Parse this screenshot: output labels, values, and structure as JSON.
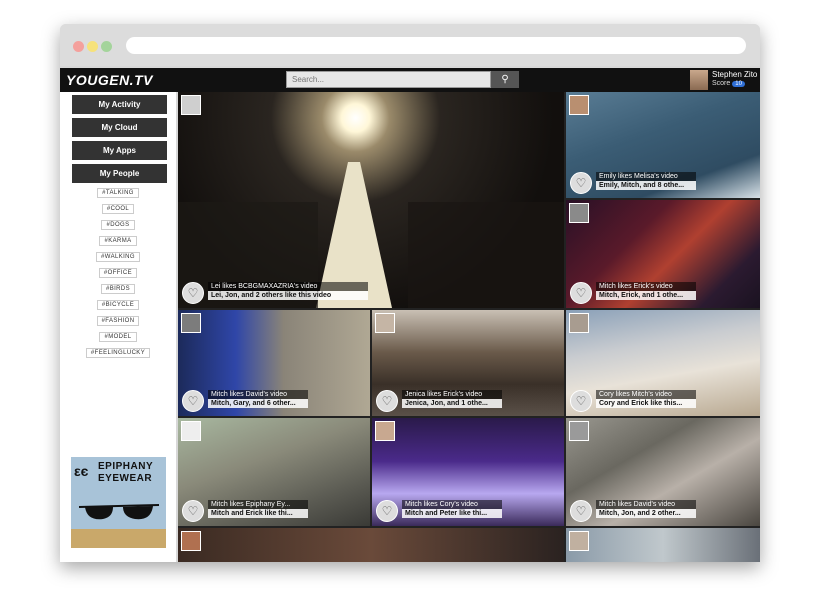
{
  "app": {
    "logo": "YOUGEN.TV"
  },
  "search": {
    "placeholder": "Search..."
  },
  "user": {
    "name": "Stephen Zito",
    "score_label": "Score",
    "score": "10"
  },
  "nav": [
    "My Activity",
    "My Cloud",
    "My Apps",
    "My People"
  ],
  "tags": [
    "#TALKING",
    "#COOL",
    "#DOGS",
    "#KARMA",
    "#WALKING",
    "#OFFICE",
    "#BIRDS",
    "#BICYCLE",
    "#FASHION",
    "#MODEL",
    "#FEELINGLUCKY"
  ],
  "ad": {
    "line1": "EPIPHANY",
    "line2": "EYEWEAR"
  },
  "tiles": [
    {
      "l1": "Lei likes BCBGMAXAZRIA's video",
      "l2": "Lei, Jon, and 2 others like this video"
    },
    {
      "l1": "Emily likes Melisa's video",
      "l2": "Emily, Mitch, and 8 othe..."
    },
    {
      "l1": "Mitch likes Erick's video",
      "l2": "Mitch, Erick, and 1 othe..."
    },
    {
      "l1": "Mitch likes David's video",
      "l2": "Mitch, Gary, and 6 other..."
    },
    {
      "l1": "Jenica likes Erick's video",
      "l2": "Jenica, Jon, and 1 othe..."
    },
    {
      "l1": "Cory likes Mitch's video",
      "l2": "Cory and Erick like this..."
    },
    {
      "l1": "Mitch likes Epiphany Ey...",
      "l2": "Mitch and Erick like thi..."
    },
    {
      "l1": "Mitch likes Cory's video",
      "l2": "Mitch and Peter like thi..."
    },
    {
      "l1": "Mitch likes David's video",
      "l2": "Mitch, Jon, and 2 other..."
    }
  ]
}
